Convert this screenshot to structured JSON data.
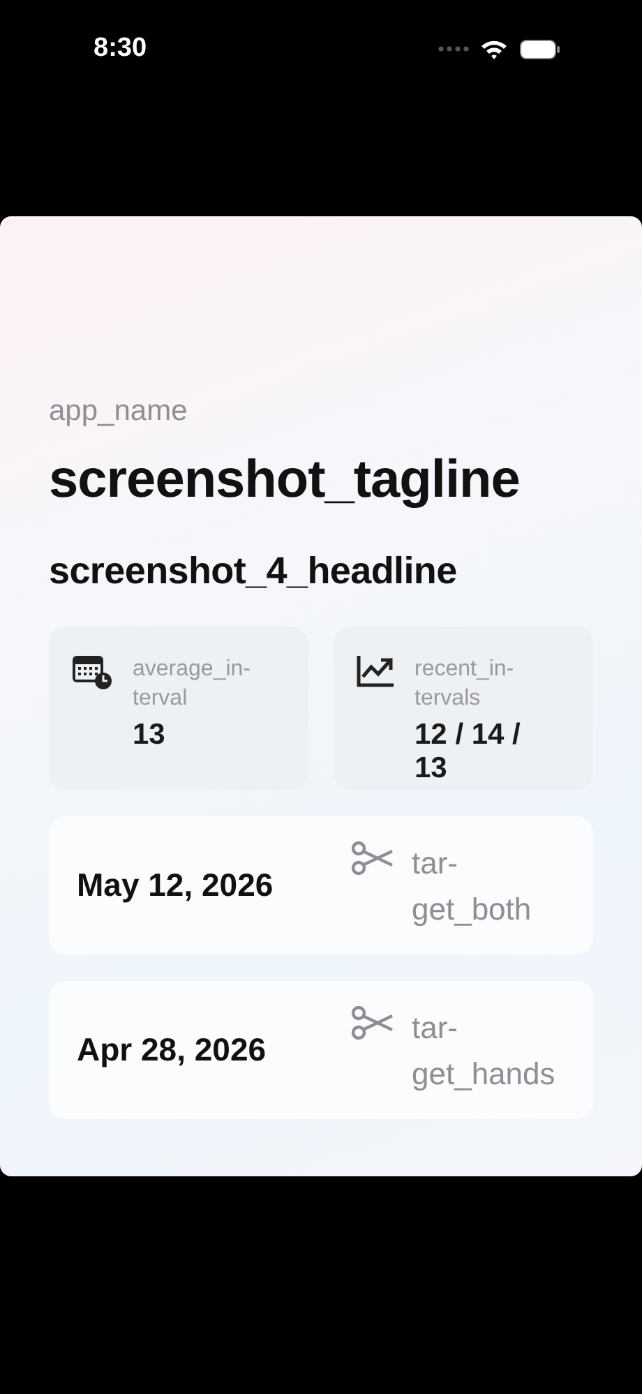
{
  "status_bar": {
    "time": "8:30"
  },
  "app_name": "app_name",
  "tagline": "screenshot_tagline",
  "headline": "screenshot_4_headline",
  "stats": [
    {
      "kind": "calendar",
      "label": "average_in-terval",
      "value": "13"
    },
    {
      "kind": "trend",
      "label": "recent_in-tervals",
      "value": "12 / 14 / 13"
    }
  ],
  "entries": [
    {
      "date": "May 12, 2026",
      "target": "tar-get_both"
    },
    {
      "date": "Apr 28, 2026",
      "target": "tar-get_hands"
    }
  ]
}
